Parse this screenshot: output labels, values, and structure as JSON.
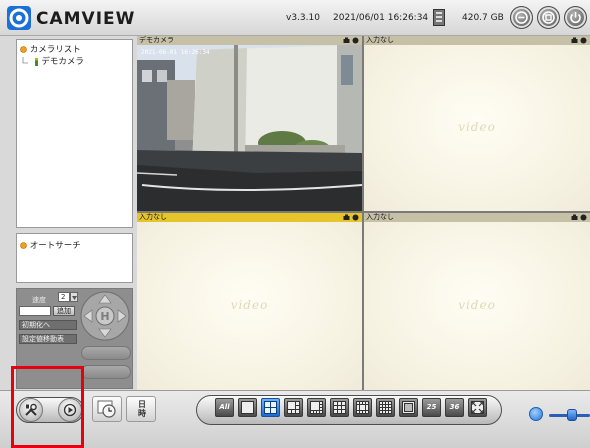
{
  "titlebar": {
    "app_name": "CAMVIEW",
    "version": "v3.3.10",
    "datetime": "2021/06/01 16:26:34",
    "storage": "420.7 GB",
    "buttons": [
      "minimize-icon",
      "maximize-icon",
      "power-icon"
    ]
  },
  "sidebar": {
    "camera_list_title": "カメラリスト",
    "camera_item": "デモカメラ",
    "autosearch_title": "オートサーチ",
    "ptz": {
      "preset_label": "速度",
      "preset_value": "2",
      "add_button": "追加",
      "init_position": "初期化へ",
      "preset_setting": "設定値移動表"
    }
  },
  "grid": {
    "tiles": [
      {
        "label": "デモカメラ",
        "active": false,
        "has_video": true,
        "overlay_timestamp": "2021-06-01 16:26:34"
      },
      {
        "label": "入力なし",
        "active": false,
        "has_video": false
      },
      {
        "label": "入力なし",
        "active": true,
        "has_video": false
      },
      {
        "label": "入力なし",
        "active": false,
        "has_video": false
      }
    ],
    "watermark": "video"
  },
  "bottombar": {
    "datetime_button": [
      "日",
      "時"
    ],
    "layout_buttons": [
      "All",
      "1",
      "4",
      "6",
      "8",
      "9",
      "13",
      "16",
      "25",
      "36",
      "full"
    ],
    "layout_selected": "4"
  },
  "colors": {
    "active_tile_header": "#e6c52b",
    "tile_header": "#c6c0a7",
    "highlight": "#e60012",
    "layout_selected": "#1d6bd1"
  }
}
